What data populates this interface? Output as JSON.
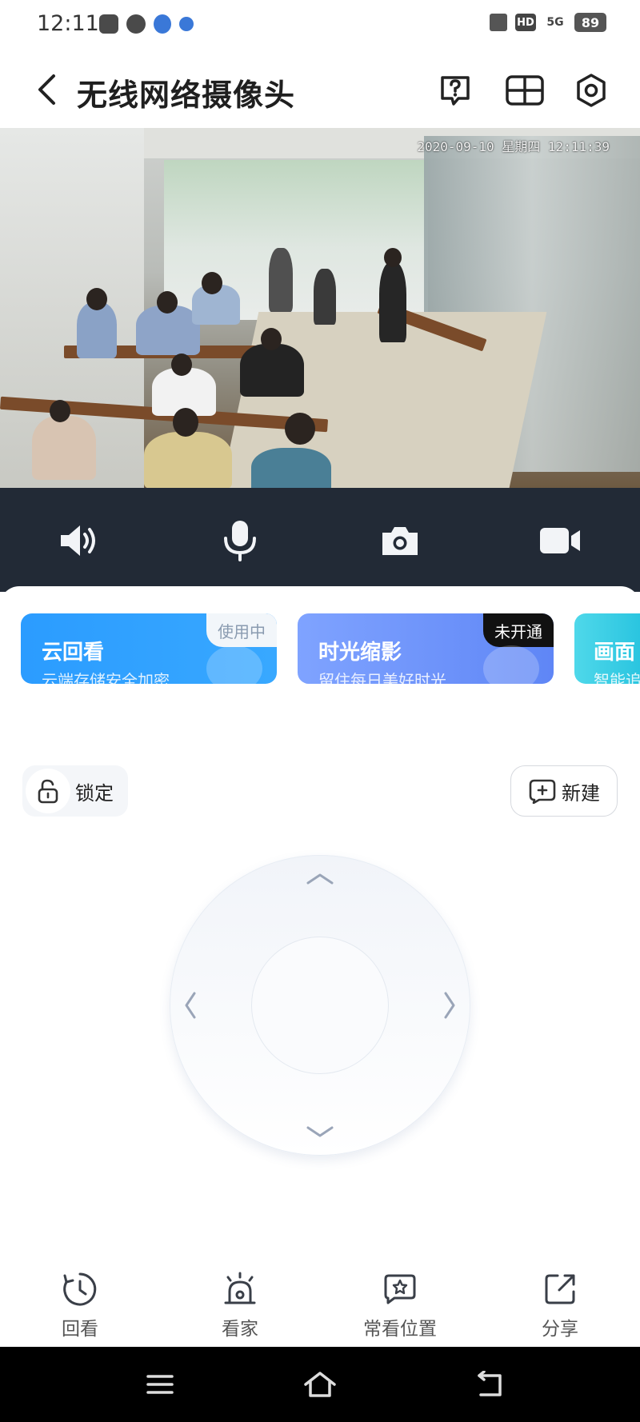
{
  "status_bar": {
    "time": "12:11",
    "hd_label": "HD",
    "network": "5G",
    "battery": "89"
  },
  "header": {
    "title": "无线网络摄像头",
    "icons": [
      "back-icon",
      "help-icon",
      "layout-grid-icon",
      "settings-icon"
    ]
  },
  "video": {
    "timestamp": "2020-09-10 星期四 12:11:39"
  },
  "controls": {
    "icons": [
      "speaker-icon",
      "microphone-icon",
      "camera-icon",
      "video-record-icon"
    ]
  },
  "cards": [
    {
      "title": "云回看",
      "subtitle": "云端存储安全加密",
      "badge": "使用中",
      "color_start": "#3aa0ff",
      "color_end": "#1e8cff"
    },
    {
      "title": "时光缩影",
      "subtitle": "留住每日美好时光",
      "badge": "未开通",
      "color_start": "#7aa8ff",
      "color_end": "#5b86f5"
    },
    {
      "title": "画面",
      "subtitle": "智能追",
      "color_start": "#4dd9ea",
      "color_end": "#25c3e0"
    }
  ],
  "presets": {
    "lock_label": "锁定",
    "new_label": "新建"
  },
  "bottom_nav": [
    {
      "label": "回看",
      "icon": "playback-clock-icon"
    },
    {
      "label": "看家",
      "icon": "alarm-bell-icon"
    },
    {
      "label": "常看位置",
      "icon": "favorite-position-icon"
    },
    {
      "label": "分享",
      "icon": "share-icon"
    }
  ],
  "colors": {
    "control_bar_bg": "#222a36",
    "badge_dark": "#111111"
  }
}
